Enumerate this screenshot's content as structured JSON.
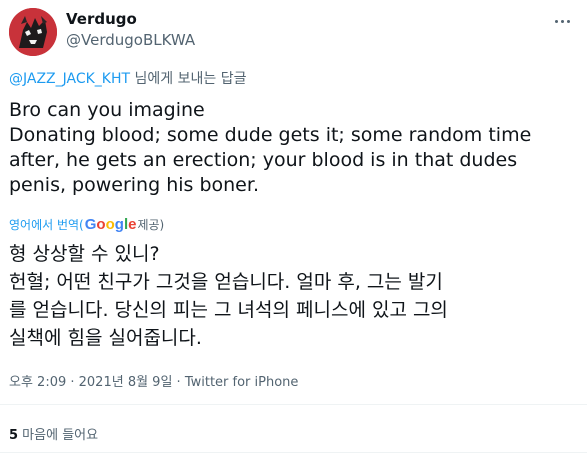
{
  "user": {
    "name": "Verdugo",
    "handle": "@VerdugoBLKWA"
  },
  "reply": {
    "mention": "@JAZZ_JACK_KHT",
    "suffix": " 님에게 보내는 답글"
  },
  "tweet": {
    "original_lines": [
      "Bro can you imagine",
      "Donating blood; some dude gets it; some random time",
      "after, he gets an erection; your blood is in that dudes",
      "penis, powering his boner."
    ],
    "translate_prefix": "영어에서 번역(",
    "google_letters": [
      "G",
      "o",
      "o",
      "g",
      "l",
      "e"
    ],
    "translate_suffix": " 제공)",
    "translated_lines": [
      "형 상상할 수 있니?",
      " 헌혈; 어떤 친구가 그것을 얻습니다. 얼마 후, 그는 발기",
      "를 얻습니다. 당신의 피는 그 녀석의 페니스에 있고 그의",
      "실책에 힘을 실어줍니다."
    ]
  },
  "meta": {
    "time_date": "오후 2:09 · 2021년 8월 9일 · ",
    "source": "Twitter for iPhone"
  },
  "stats": {
    "likes_count": "5",
    "likes_label": " 마음에 들어요"
  },
  "icons": {
    "avatar": "dark-animal-avatar",
    "more": "more-dots-icon"
  },
  "colors": {
    "link": "#1d9bf0",
    "secondary": "#536471",
    "text": "#0f1419",
    "avatar_bg": "#c8323a"
  }
}
